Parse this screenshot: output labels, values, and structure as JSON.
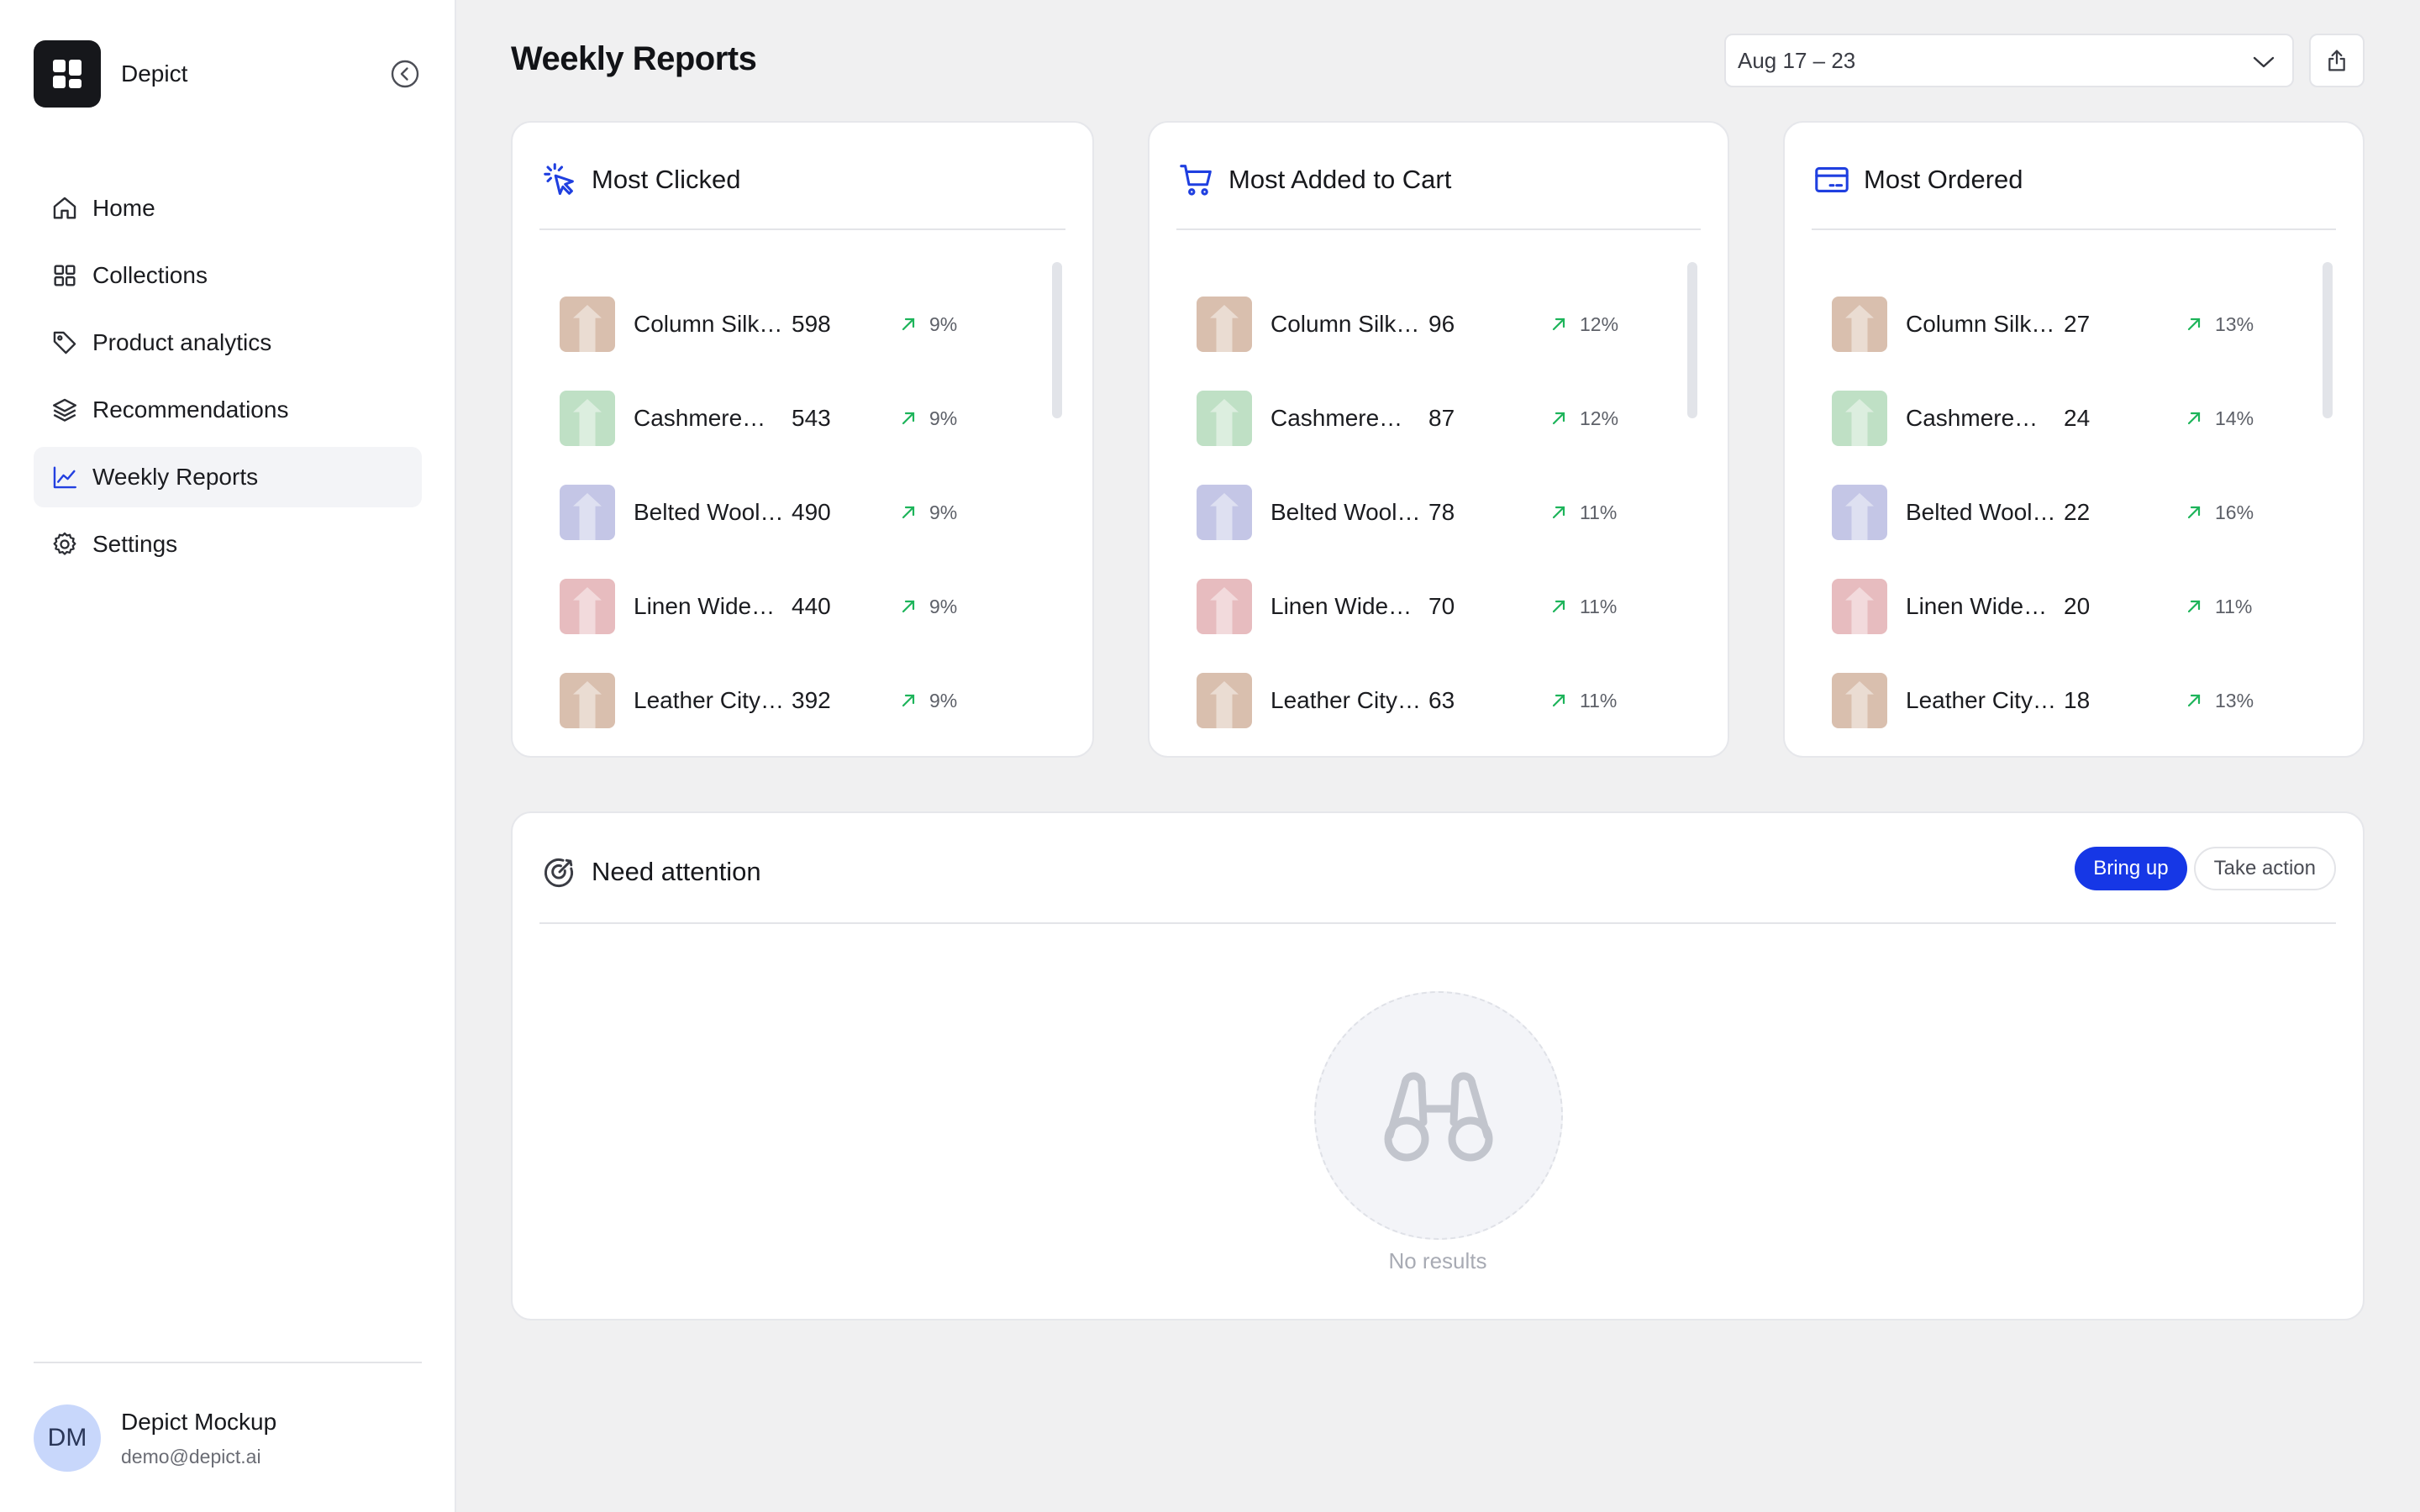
{
  "app": {
    "name": "Depict"
  },
  "sidebar": {
    "items": [
      {
        "label": "Home",
        "icon": "home-icon",
        "active": false
      },
      {
        "label": "Collections",
        "icon": "grid-icon",
        "active": false
      },
      {
        "label": "Product analytics",
        "icon": "tag-icon",
        "active": false
      },
      {
        "label": "Recommendations",
        "icon": "layers-icon",
        "active": false
      },
      {
        "label": "Weekly Reports",
        "icon": "chart-line-icon",
        "active": true
      },
      {
        "label": "Settings",
        "icon": "gear-icon",
        "active": false
      }
    ]
  },
  "user": {
    "initials": "DM",
    "name": "Depict Mockup",
    "email": "demo@depict.ai"
  },
  "header": {
    "title": "Weekly Reports",
    "date_range": "Aug 17 – 23"
  },
  "colors": {
    "accent": "#1637e6",
    "trend_up": "#1db45a",
    "thumb_tan": "#d9bfae",
    "thumb_green": "#bfe0c5",
    "thumb_lavender": "#c4c6e6",
    "thumb_pink": "#e7bcbf"
  },
  "cards": [
    {
      "title": "Most Clicked",
      "icon": "cursor-click-icon",
      "rows": [
        {
          "name": "Column Silk…",
          "value": "598",
          "trend": "9%",
          "thumb": "thumb_tan"
        },
        {
          "name": "Cashmere…",
          "value": "543",
          "trend": "9%",
          "thumb": "thumb_green"
        },
        {
          "name": "Belted Wool…",
          "value": "490",
          "trend": "9%",
          "thumb": "thumb_lavender"
        },
        {
          "name": "Linen Wide…",
          "value": "440",
          "trend": "9%",
          "thumb": "thumb_pink"
        },
        {
          "name": "Leather City…",
          "value": "392",
          "trend": "9%",
          "thumb": "thumb_tan"
        }
      ]
    },
    {
      "title": "Most Added to Cart",
      "icon": "cart-icon",
      "rows": [
        {
          "name": "Column Silk…",
          "value": "96",
          "trend": "12%",
          "thumb": "thumb_tan"
        },
        {
          "name": "Cashmere…",
          "value": "87",
          "trend": "12%",
          "thumb": "thumb_green"
        },
        {
          "name": "Belted Wool…",
          "value": "78",
          "trend": "11%",
          "thumb": "thumb_lavender"
        },
        {
          "name": "Linen Wide…",
          "value": "70",
          "trend": "11%",
          "thumb": "thumb_pink"
        },
        {
          "name": "Leather City…",
          "value": "63",
          "trend": "11%",
          "thumb": "thumb_tan"
        }
      ]
    },
    {
      "title": "Most Ordered",
      "icon": "credit-card-icon",
      "rows": [
        {
          "name": "Column Silk…",
          "value": "27",
          "trend": "13%",
          "thumb": "thumb_tan"
        },
        {
          "name": "Cashmere…",
          "value": "24",
          "trend": "14%",
          "thumb": "thumb_green"
        },
        {
          "name": "Belted Wool…",
          "value": "22",
          "trend": "16%",
          "thumb": "thumb_lavender"
        },
        {
          "name": "Linen Wide…",
          "value": "20",
          "trend": "11%",
          "thumb": "thumb_pink"
        },
        {
          "name": "Leather City…",
          "value": "18",
          "trend": "13%",
          "thumb": "thumb_tan"
        }
      ]
    }
  ],
  "attention": {
    "title": "Need attention",
    "icon": "target-icon",
    "tabs": [
      {
        "label": "Bring up",
        "active": true
      },
      {
        "label": "Take action",
        "active": false
      }
    ],
    "empty_icon": "binoculars-icon",
    "empty_text": "No results"
  }
}
